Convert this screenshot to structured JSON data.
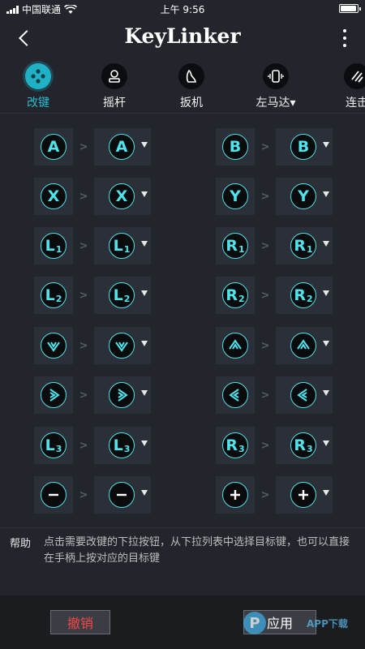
{
  "status_bar": {
    "carrier": "中国联通",
    "time": "上午 9:56"
  },
  "header": {
    "title": "KeyLinker"
  },
  "tabs": [
    {
      "label": "改键",
      "icon": "gamepad-icon",
      "active": true
    },
    {
      "label": "摇杆",
      "icon": "joystick-icon",
      "active": false
    },
    {
      "label": "扳机",
      "icon": "trigger-icon",
      "active": false
    },
    {
      "label": "左马达▾",
      "icon": "vibration-icon",
      "active": false
    },
    {
      "label": "连击",
      "icon": "turbo-icon",
      "active": false
    }
  ],
  "mappings": [
    [
      {
        "src": "A",
        "dst": "A"
      },
      {
        "src": "B",
        "dst": "B"
      }
    ],
    [
      {
        "src": "X",
        "dst": "X"
      },
      {
        "src": "Y",
        "dst": "Y"
      }
    ],
    [
      {
        "src": "L1",
        "dst": "L1"
      },
      {
        "src": "R1",
        "dst": "R1"
      }
    ],
    [
      {
        "src": "L2",
        "dst": "L2"
      },
      {
        "src": "R2",
        "dst": "R2"
      }
    ],
    [
      {
        "src": "dpad-down",
        "dst": "dpad-down"
      },
      {
        "src": "dpad-up",
        "dst": "dpad-up"
      }
    ],
    [
      {
        "src": "dpad-right",
        "dst": "dpad-right"
      },
      {
        "src": "dpad-left",
        "dst": "dpad-left"
      }
    ],
    [
      {
        "src": "L3",
        "dst": "L3"
      },
      {
        "src": "R3",
        "dst": "R3"
      }
    ],
    [
      {
        "src": "minus",
        "dst": "minus"
      },
      {
        "src": "plus",
        "dst": "plus"
      }
    ]
  ],
  "help": {
    "label": "帮助",
    "text": "点击需要改键的下拉按钮，从下拉列表中选择目标键，也可以直接在手柄上按对应的目标键"
  },
  "footer": {
    "cancel_label": "撤销",
    "apply_label": "应用",
    "watermark_logo": "P",
    "watermark_text": "APP下载"
  },
  "colors": {
    "accent": "#4fe3ec",
    "tab_active": "#27bcd2",
    "cancel_text": "#f24848",
    "background": "#22252b"
  }
}
